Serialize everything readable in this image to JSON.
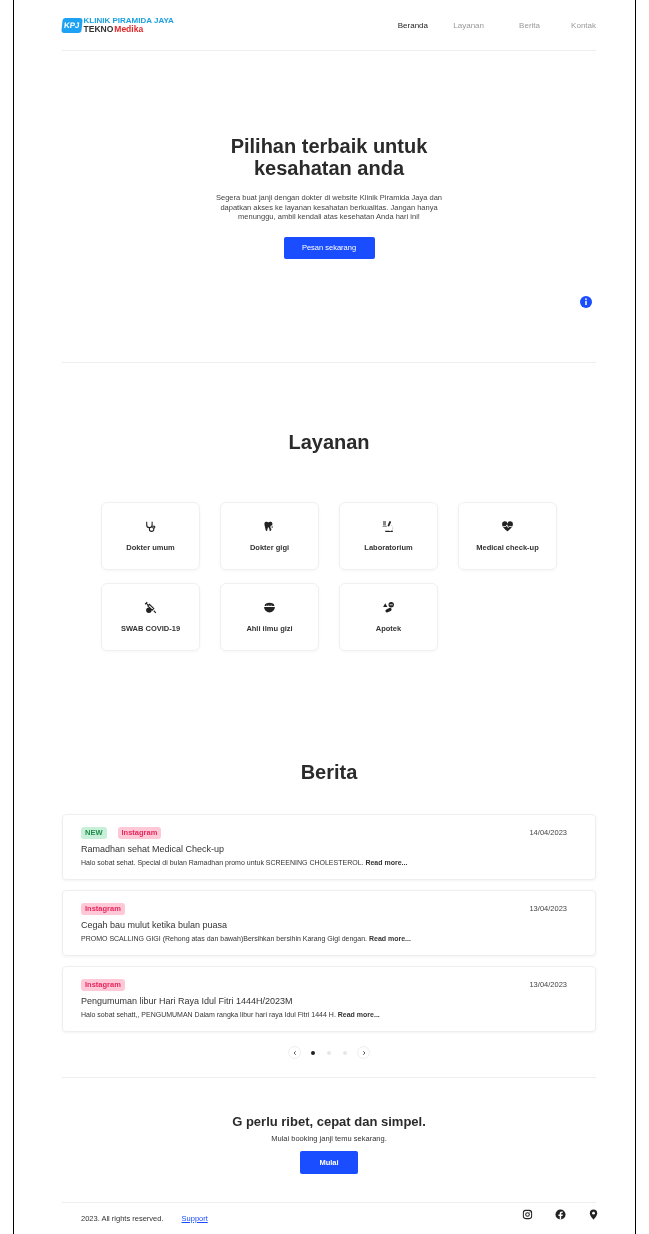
{
  "header": {
    "logo_badge": "KPJ",
    "logo_title": "KLINIK PIRAMIDA JAYA",
    "logo_sub": [
      {
        "text": "TEKNO",
        "color": "#333333"
      },
      {
        "text": "Medika",
        "color": "#e02828"
      }
    ],
    "nav": [
      {
        "label": "Beranda",
        "selected": true
      },
      {
        "label": "Layanan",
        "selected": false
      },
      {
        "label": "Berita",
        "selected": false
      },
      {
        "label": "Kontak",
        "selected": false
      }
    ]
  },
  "hero": {
    "title": "Pilihan terbaik untuk kesahatan anda",
    "text": "Segera buat janji dengan dokter di website Klinik Piramida Jaya dan dapatkan akses ke layanan kesahatan berkualitas. Jangan hanya menunggu, ambil kendali atas kesehatan Anda hari ini!",
    "button": "Pesan sekarang"
  },
  "services": {
    "title": "Layanan",
    "items": [
      {
        "label": "Dokter umum"
      },
      {
        "label": "Dokter gigi"
      },
      {
        "label": "Laboratorium"
      },
      {
        "label": "Medical check-up"
      },
      {
        "label": "SWAB COVID-19"
      },
      {
        "label": "Ahli ilmu gizi"
      },
      {
        "label": "Apotek"
      }
    ]
  },
  "news": {
    "title": "Berita",
    "items": [
      {
        "tags": [
          {
            "label": "NEW",
            "color": "#c8f0d8"
          },
          {
            "label": "Instagram",
            "color": "#ffc8d6"
          }
        ],
        "date": "14/04/2023",
        "title": "Ramadhan sehat Medical Check-up",
        "excerpt": "Halo sobat sehat. Special di bulan Ramadhan promo untuk SCREENING CHOLESTEROL. **Read more...**"
      },
      {
        "tags": [
          {
            "label": "Instagram",
            "color": "#ffc8d6"
          }
        ],
        "date": "13/04/2023",
        "title": "Cegah bau mulut ketika bulan puasa",
        "excerpt": "PROMO SCALLING GIGI (Rehong atas dan bawah)Bersihkan bersihin Karang Gigi dengan. **Read more...**"
      },
      {
        "tags": [
          {
            "label": "Instagram",
            "color": "#ffc8d6"
          }
        ],
        "date": "13/04/2023",
        "title": "Pengumuman libur Hari Raya Idul Fitri 1444H/2023M",
        "excerpt": "Halo sobat sehatt,, PENGUMUMAN Dalam rangka libur hari raya Idul Fitri 1444 H. **Read more...**"
      }
    ],
    "pages": [
      {
        "selected": true
      },
      {
        "selected": false
      },
      {
        "selected": false
      }
    ]
  },
  "cta": {
    "title": "G perlu ribet, cepat dan simpel.",
    "text": "Mulai booking janji temu sekarang.",
    "button": "Mulai"
  },
  "footer": {
    "copyright": "2023. All rights reserved.",
    "link": "Support"
  }
}
